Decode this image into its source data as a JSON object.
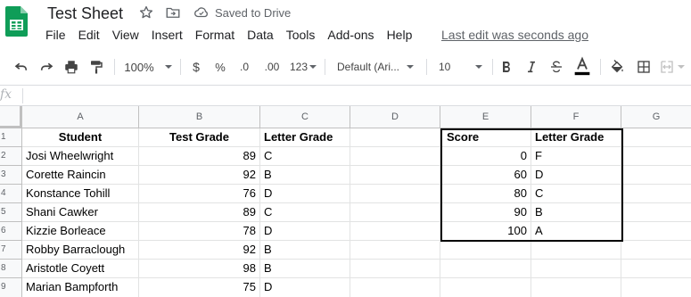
{
  "app": {
    "title": "Test Sheet",
    "saved_status": "Saved to Drive",
    "last_edit": "Last edit was seconds ago",
    "brand_color": "#0f9d58"
  },
  "menu": [
    "File",
    "Edit",
    "View",
    "Insert",
    "Format",
    "Data",
    "Tools",
    "Add-ons",
    "Help"
  ],
  "toolbar": {
    "zoom": "100%",
    "currency": "$",
    "percent": "%",
    "decrease_decimals": ".0",
    "increase_decimals": ".00",
    "more_formats": "123",
    "font": "Default (Ari...",
    "font_size": "10",
    "icons": [
      "undo-icon",
      "redo-icon",
      "print-icon",
      "paint-format-icon",
      "bold-icon",
      "italic-icon",
      "strikethrough-icon",
      "text-color-icon",
      "fill-color-icon",
      "borders-icon",
      "merge-cells-icon"
    ]
  },
  "formula_bar": {
    "fx": "fx",
    "value": ""
  },
  "sheet": {
    "columns": [
      "A",
      "B",
      "C",
      "D",
      "E",
      "F",
      "G"
    ],
    "rows": [
      {
        "n": "1",
        "a": "Student",
        "b": "Test Grade",
        "c": "Letter Grade",
        "d": "",
        "e": "Score",
        "f": "Letter Grade"
      },
      {
        "n": "2",
        "a": "Josi Wheelwright",
        "b": "89",
        "c": "C",
        "d": "",
        "e": "0",
        "f": "F"
      },
      {
        "n": "3",
        "a": "Corette Raincin",
        "b": "92",
        "c": "B",
        "d": "",
        "e": "60",
        "f": "D"
      },
      {
        "n": "4",
        "a": "Konstance Tohill",
        "b": "76",
        "c": "D",
        "d": "",
        "e": "80",
        "f": "C"
      },
      {
        "n": "5",
        "a": "Shani Cawker",
        "b": "89",
        "c": "C",
        "d": "",
        "e": "90",
        "f": "B"
      },
      {
        "n": "6",
        "a": "Kizzie Borleace",
        "b": "78",
        "c": "D",
        "d": "",
        "e": "100",
        "f": "A"
      },
      {
        "n": "7",
        "a": "Robby Barraclough",
        "b": "92",
        "c": "B",
        "d": "",
        "e": "",
        "f": ""
      },
      {
        "n": "8",
        "a": "Aristotle Coyett",
        "b": "98",
        "c": "B",
        "d": "",
        "e": "",
        "f": ""
      },
      {
        "n": "9",
        "a": "Marian Bampforth",
        "b": "75",
        "c": "D",
        "d": "",
        "e": "",
        "f": ""
      }
    ]
  }
}
